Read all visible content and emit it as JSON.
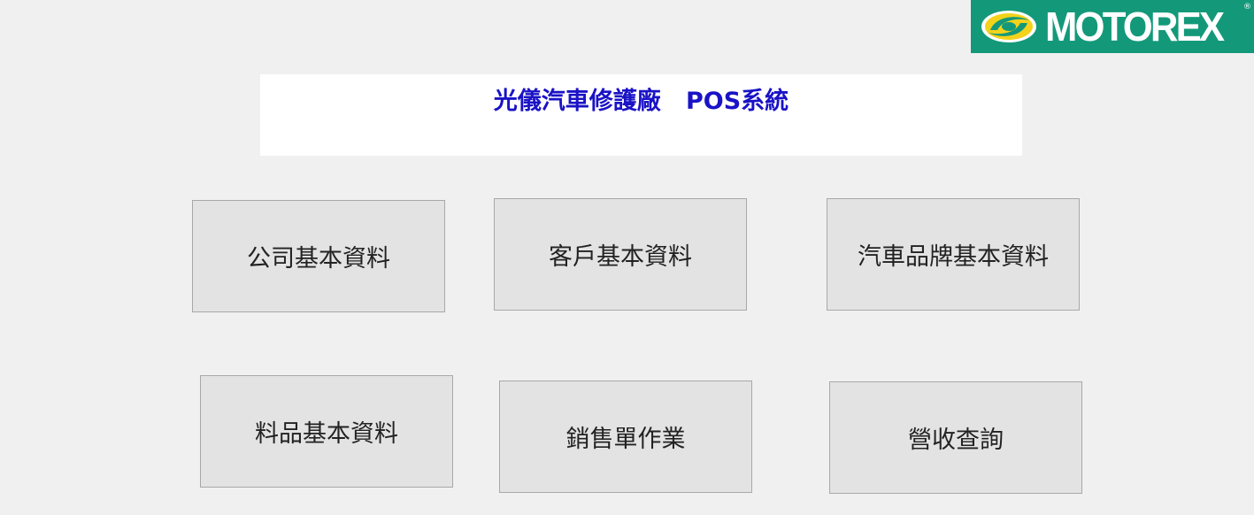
{
  "logo": {
    "text": "MOTOREX",
    "registered_mark": "®",
    "background_color": "#13997a",
    "mark_color": "#f3d21c",
    "icon": "motorex-swirl-icon"
  },
  "header": {
    "title": "光儀汽車修護廠   POS系統",
    "title_color": "#1a12c6"
  },
  "menu": {
    "company_info": "公司基本資料",
    "customer_info": "客戶基本資料",
    "car_brand_info": "汽車品牌基本資料",
    "material_info": "料品基本資料",
    "sales_order": "銷售單作業",
    "revenue_query": "營收查詢"
  }
}
